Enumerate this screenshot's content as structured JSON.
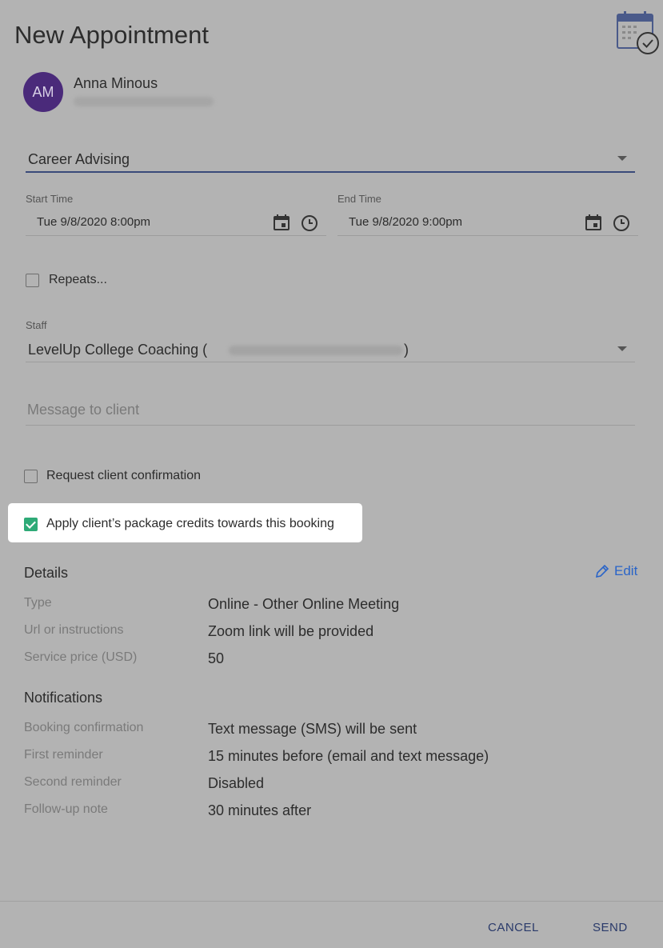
{
  "title": "New Appointment",
  "client": {
    "initials": "AM",
    "name": "Anna Minous"
  },
  "service": {
    "value": "Career Advising"
  },
  "start_time": {
    "label": "Start Time",
    "value": "Tue 9/8/2020 8:00pm"
  },
  "end_time": {
    "label": "End Time",
    "value": "Tue 9/8/2020 9:00pm"
  },
  "repeats": {
    "label": "Repeats...",
    "checked": false
  },
  "staff": {
    "label": "Staff",
    "value_prefix": "LevelUp College Coaching (",
    "value_suffix": ")"
  },
  "message": {
    "placeholder": "Message to client"
  },
  "request_confirmation": {
    "label": "Request client confirmation",
    "checked": false
  },
  "apply_credits": {
    "label": "Apply client’s package credits towards this booking",
    "checked": true
  },
  "details": {
    "title": "Details",
    "edit_label": "Edit",
    "rows": [
      {
        "label": "Type",
        "value": "Online - Other Online Meeting"
      },
      {
        "label": "Url or instructions",
        "value": "Zoom link will be provided"
      },
      {
        "label": "Service price (USD)",
        "value": "50"
      }
    ]
  },
  "notifications": {
    "title": "Notifications",
    "rows": [
      {
        "label": "Booking confirmation",
        "value": "Text message (SMS) will be sent"
      },
      {
        "label": "First reminder",
        "value": "15 minutes before (email and text message)"
      },
      {
        "label": "Second reminder",
        "value": "Disabled"
      },
      {
        "label": "Follow-up note",
        "value": "30 minutes after"
      }
    ]
  },
  "footer": {
    "cancel_label": "CANCEL",
    "send_label": "SEND"
  },
  "colors": {
    "overlay_bg": "#b3b3b3",
    "accent_blue": "#2a64c8",
    "check_green": "#2eaa77",
    "avatar_purple": "#4a2a7a"
  },
  "icons": [
    "calendar-check-icon",
    "calendar-icon",
    "clock-icon",
    "caret-down-icon",
    "pencil-icon",
    "checkmark-icon"
  ]
}
